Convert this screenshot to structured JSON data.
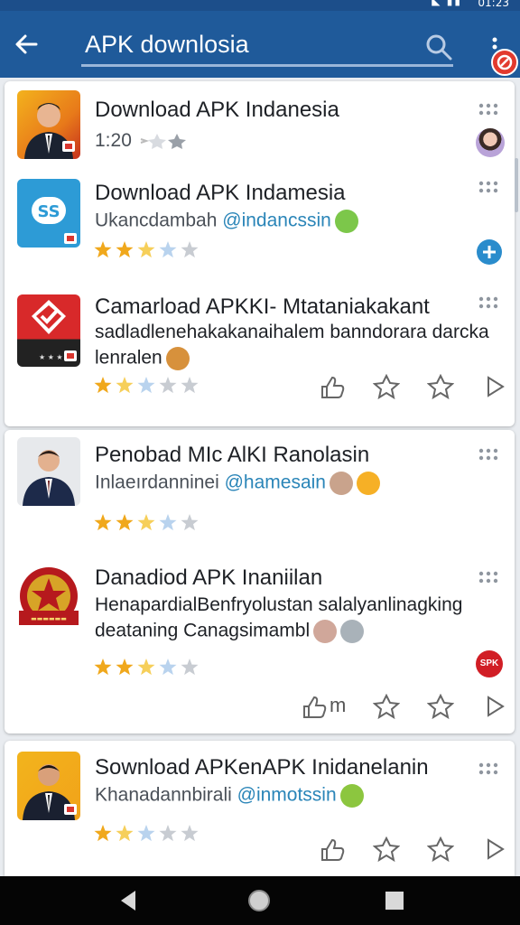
{
  "status_bar": {
    "time": "01:23",
    "icons": "◣ ▮▮"
  },
  "app_bar": {
    "query": "APK downlosia"
  },
  "items": [
    {
      "title": "Download APK Indanesia",
      "subtitle": "1:20",
      "rating": 0,
      "has_avatar": true
    },
    {
      "title": "Download APK Indamesia",
      "subtitle_prefix": "Ukancdambah ",
      "subtitle_handle": "@indancssin",
      "rating": 2.5
    },
    {
      "title": "Camarload APKKI- Mtataniakakant",
      "line2": "sadladlenehakakanaihalem banndorara darcka",
      "line3": "lenralen",
      "rating": 1.5
    },
    {
      "title": "Penobad MIc AlKI Ranolasin",
      "subtitle_prefix": "Inlaeırdanninei ",
      "subtitle_handle": "@hamesain",
      "rating": 2.5
    },
    {
      "title": "Danadiod APK Inaniilan",
      "line2": "HenapardialBenfryolustan salalyanlinagking",
      "line3": "deataning Canagsimambl",
      "rating": 3,
      "action_text": "m",
      "badge": "SPK"
    },
    {
      "title": "Sownload APKenAPK Inidanelanin",
      "subtitle_prefix": "Khanadannbirali ",
      "subtitle_handle": "@inmotssin",
      "rating": 1.5
    }
  ],
  "icons": {
    "back": "arrow-left",
    "search": "magnifier",
    "overflow": "vertical-dots",
    "more": "dots-grid",
    "like": "thumbs-up",
    "star": "star",
    "play": "play-triangle",
    "add": "plus-circle"
  },
  "colors": {
    "app_bar": "#1f5a9a",
    "star_filled": "#f0a81c",
    "star_empty": "#c8ccd2",
    "accent": "#2a85b8"
  }
}
